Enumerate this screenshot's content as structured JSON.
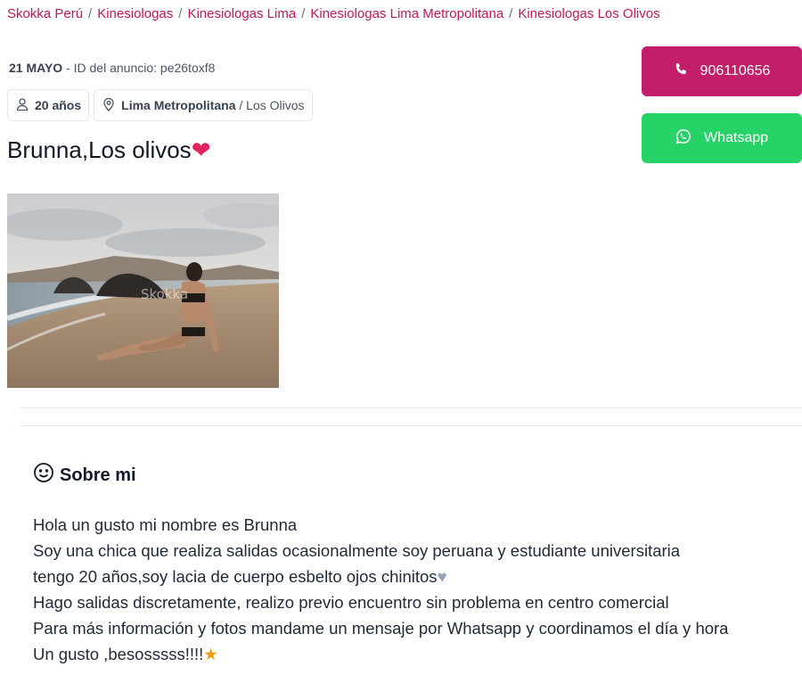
{
  "breadcrumb": [
    "Skokka Perú",
    "Kinesiologas",
    "Kinesiologas Lima",
    "Kinesiologas Lima Metropolitana",
    "Kinesiologas Los Olivos"
  ],
  "meta": {
    "date": "21 MAYO",
    "id_text": " - ID del anuncio: pe26toxf8"
  },
  "chips": {
    "age": "20 años",
    "region": "Lima Metropolitana",
    "district": " / Los Olivos"
  },
  "listing": {
    "title": "Brunna,Los olivos",
    "title_emoji": "❤"
  },
  "photo": {
    "watermark": "Skokka"
  },
  "contact": {
    "phone_label": "906110656",
    "whatsapp_label": "Whatsapp"
  },
  "about": {
    "heading": "Sobre mi",
    "lines": [
      "Hola un gusto mi nombre es Brunna",
      "Soy una chica que realiza salidas ocasionalmente soy peruana y estudiante universitaria",
      "tengo 20 años,soy lacia de cuerpo esbelto ojos chinitos",
      "Hago salidas discretamente, realizo previo encuentro sin problema en centro comercial",
      "Para más información y fotos mandame un mensaje por Whatsapp y coordinamos el día y hora",
      "Un gusto ,besosssss!!!!"
    ],
    "line3_emoji": "♥",
    "line6_emoji": "★"
  },
  "colors": {
    "brand": "#c21e6a",
    "whatsapp": "#25d366",
    "link": "#c2185b"
  }
}
